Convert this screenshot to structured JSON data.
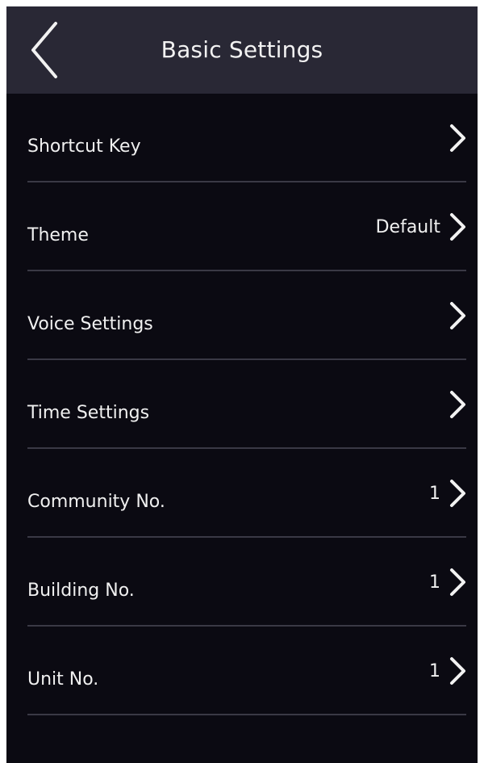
{
  "header": {
    "title": "Basic Settings",
    "back_icon": "chevron-left-icon"
  },
  "settings": {
    "items": [
      {
        "label": "Shortcut Key",
        "value": ""
      },
      {
        "label": "Theme",
        "value": "Default"
      },
      {
        "label": "Voice Settings",
        "value": ""
      },
      {
        "label": "Time Settings",
        "value": ""
      },
      {
        "label": "Community No.",
        "value": "1"
      },
      {
        "label": "Building No.",
        "value": "1"
      },
      {
        "label": "Unit No.",
        "value": "1"
      }
    ],
    "row_icon": "chevron-right-icon"
  },
  "colors": {
    "background": "#0b0a12",
    "header_background": "#292835",
    "text": "#f0f0f0",
    "divider": "#3a3945"
  }
}
